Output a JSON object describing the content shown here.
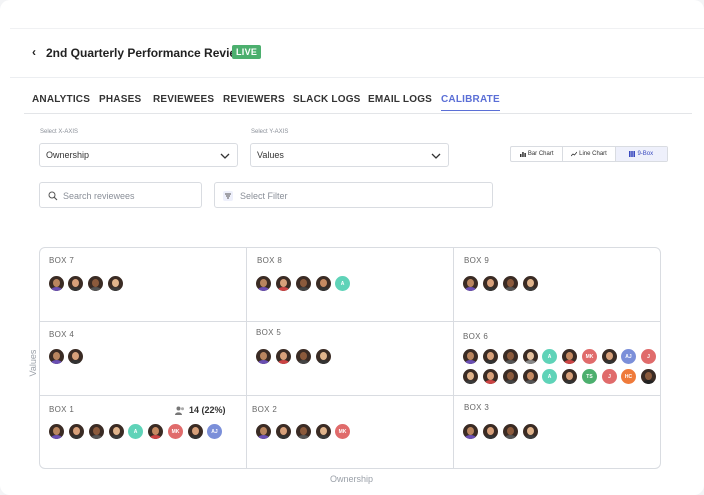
{
  "header": {
    "back": "‹",
    "title": "2nd Quarterly Performance Review",
    "badge": "LIVE"
  },
  "tabs": [
    {
      "label": "ANALYTICS"
    },
    {
      "label": "PHASES"
    },
    {
      "label": "REVIEWEES"
    },
    {
      "label": "REVIEWERS"
    },
    {
      "label": "SLACK LOGS"
    },
    {
      "label": "EMAIL LOGS"
    },
    {
      "label": "CALIBRATE"
    }
  ],
  "active_tab": "CALIBRATE",
  "x_axis": {
    "label": "Select X-AXIS",
    "value": "Ownership"
  },
  "y_axis": {
    "label": "Select Y-AXIS",
    "value": "Values"
  },
  "view_toggle": [
    {
      "label": "Bar Chart",
      "icon": "bar-chart-icon"
    },
    {
      "label": "Line Chart",
      "icon": "line-chart-icon"
    },
    {
      "label": "9-Box",
      "icon": "grid-icon"
    }
  ],
  "search": {
    "placeholder": "Search reviewees"
  },
  "filter": {
    "placeholder": "Select Filter"
  },
  "boxes": {
    "box7": {
      "title": "BOX 7"
    },
    "box8": {
      "title": "BOX 8"
    },
    "box9": {
      "title": "BOX 9"
    },
    "box4": {
      "title": "BOX 4"
    },
    "box5": {
      "title": "BOX 5"
    },
    "box6": {
      "title": "BOX 6"
    },
    "box1": {
      "title": "BOX 1",
      "count": "14 (22%)"
    },
    "box2": {
      "title": "BOX 2"
    },
    "box3": {
      "title": "BOX 3"
    }
  },
  "avatar_initials": {
    "a": "A",
    "mk": "MK",
    "aj": "AJ",
    "j": "J",
    "ts": "TS",
    "hc": "HC"
  },
  "colors": {
    "accent": "#5b6fd6",
    "live": "#4caf6e",
    "teal": "#5fd3b8",
    "coral": "#e06b6b",
    "periwinkle": "#7b8fd9",
    "green": "#4caf6e",
    "orange": "#ef7a3a"
  },
  "axis_labels": {
    "x": "Ownership",
    "y": "Values"
  }
}
